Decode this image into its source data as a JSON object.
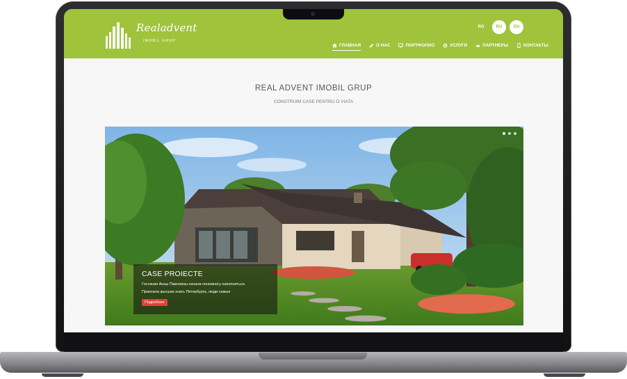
{
  "header": {
    "logo": {
      "name": "Realadvent",
      "subtitle": "IMOBIL GRUP"
    },
    "languages": [
      "RO",
      "RU",
      "EN"
    ],
    "nav": [
      {
        "label": "ГЛАВНАЯ",
        "icon": "home-icon",
        "active": true
      },
      {
        "label": "О НАС",
        "icon": "pencil-icon",
        "active": false
      },
      {
        "label": "ПОРТФОЛИО",
        "icon": "monitor-icon",
        "active": false
      },
      {
        "label": "УСЛУГИ",
        "icon": "gear-icon",
        "active": false
      },
      {
        "label": "ПАРТНЕРЫ",
        "icon": "handshake-icon",
        "active": false
      },
      {
        "label": "КОНТАКТЫ",
        "icon": "phone-icon",
        "active": false
      }
    ]
  },
  "intro": {
    "title": "REAL ADVENT IMOBIL GRUP",
    "subtitle": "CONSTRUIM CASE PENTRU O VIATA"
  },
  "slider": {
    "slides_count": 3,
    "active_index": 0,
    "caption": {
      "title": "CASE PROIECTE",
      "text_line1": "Гостиная Анны Павловны начала понемногу наполняться.",
      "text_line2": "Приехала высшая знать Петербурга, люди самые",
      "button_label": "Подробнее"
    }
  },
  "colors": {
    "header_green": "#9fc33b",
    "button_red": "#e4403b"
  }
}
